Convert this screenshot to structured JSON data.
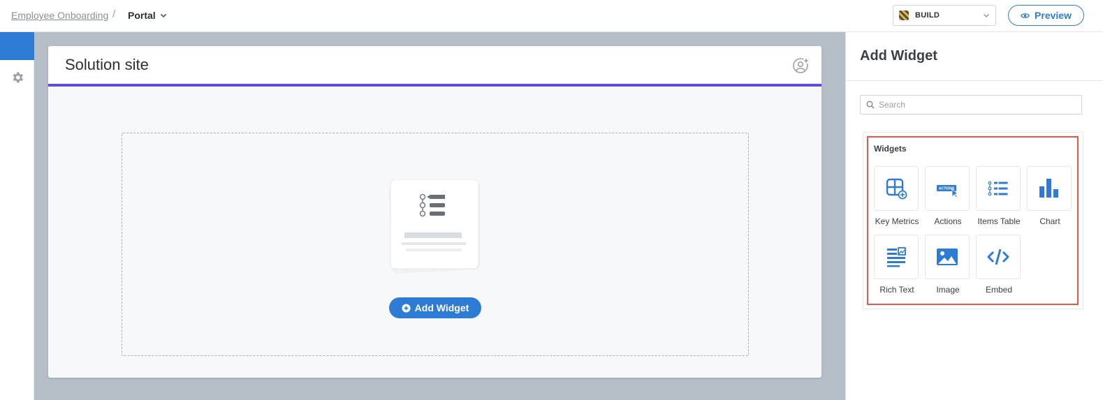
{
  "breadcrumb": {
    "parent": "Employee Onboarding",
    "separator": "/",
    "current": "Portal"
  },
  "mode": {
    "label": "BUILD"
  },
  "preview": {
    "label": "Preview"
  },
  "site": {
    "title": "Solution site"
  },
  "dropzone": {
    "button_label": "Add Widget"
  },
  "panel": {
    "title": "Add Widget",
    "search_placeholder": "Search",
    "section_label": "Widgets",
    "widgets": [
      {
        "label": "Key Metrics",
        "icon": "key-metrics-icon"
      },
      {
        "label": "Actions",
        "icon": "actions-icon",
        "icon_text": "ACTIONS"
      },
      {
        "label": "Items Table",
        "icon": "items-table-icon"
      },
      {
        "label": "Chart",
        "icon": "chart-icon"
      },
      {
        "label": "Rich Text",
        "icon": "rich-text-icon"
      },
      {
        "label": "Image",
        "icon": "image-icon"
      },
      {
        "label": "Embed",
        "icon": "embed-icon"
      }
    ]
  },
  "colors": {
    "accent": "#2e7bd6",
    "header_underline": "#5b4fe0",
    "highlight": "#e8574a",
    "canvas_bg": "#b6bec8"
  }
}
